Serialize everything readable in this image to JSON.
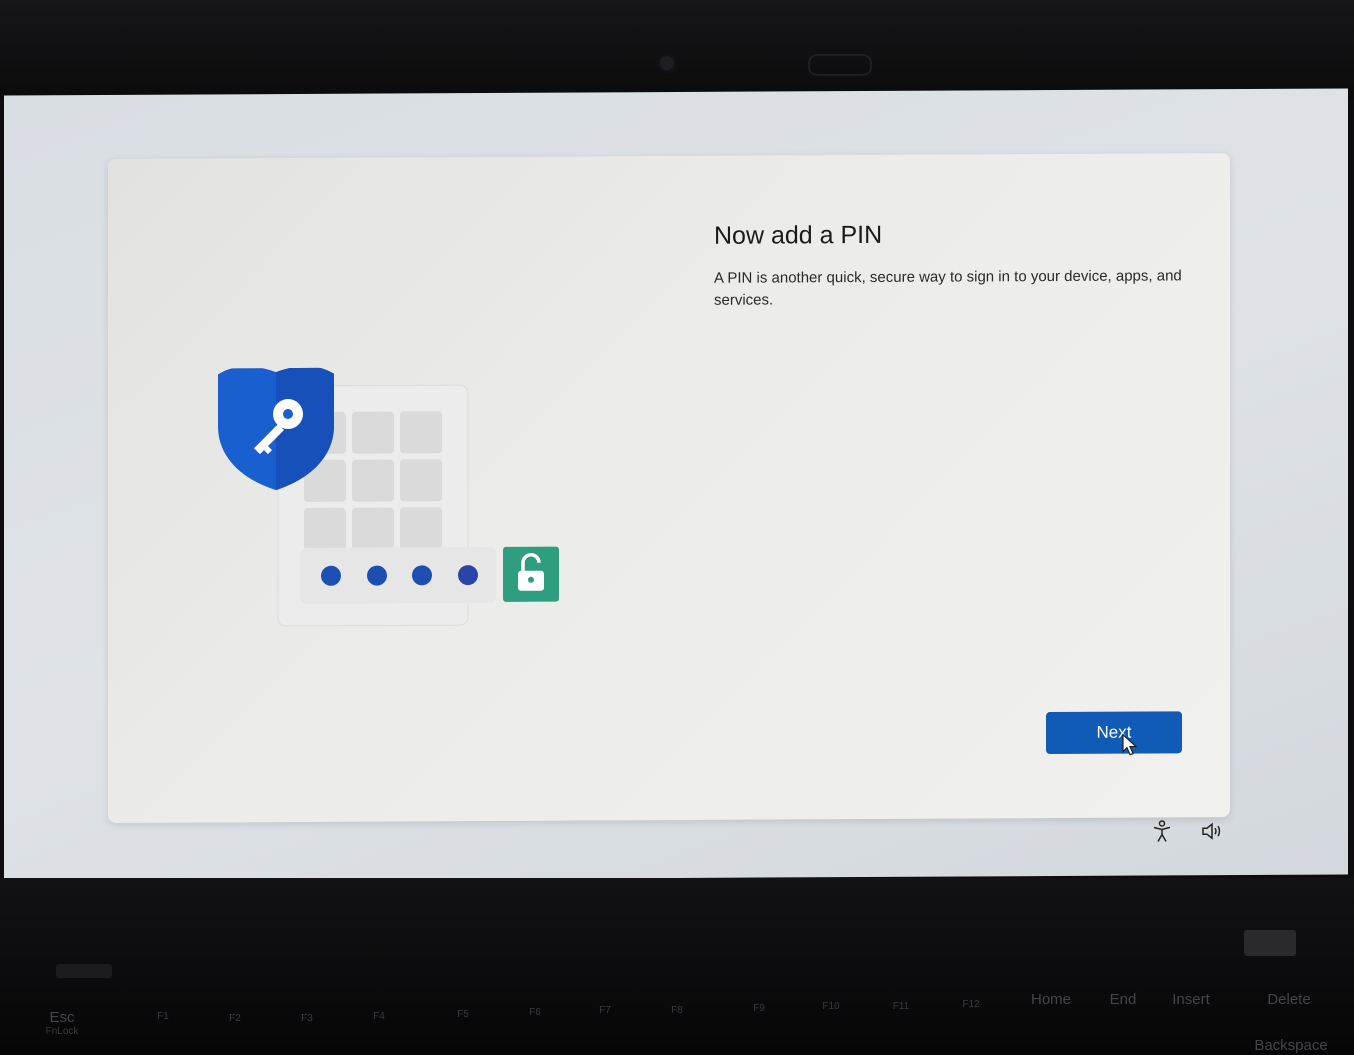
{
  "screen": {
    "title": "Now add a PIN",
    "description": "A PIN is another quick, secure way to sign in to your device, apps, and services.",
    "next_button_label": "Next",
    "accessibility_icon": "accessibility-icon",
    "volume_icon": "volume-icon"
  },
  "colors": {
    "accent": "#0f5bb5",
    "shield": "#1a5fcf",
    "lock_tile": "#2e9e7e",
    "pin_dot": "#1d4fb3"
  },
  "keyboard": {
    "keys": [
      {
        "label": "Esc",
        "sub": "FnLock"
      },
      {
        "label": "",
        "sub": "F1"
      },
      {
        "label": "",
        "sub": "F2"
      },
      {
        "label": "",
        "sub": "F3"
      },
      {
        "label": "",
        "sub": "F4"
      },
      {
        "label": "",
        "sub": "F5"
      },
      {
        "label": "",
        "sub": "F6"
      },
      {
        "label": "",
        "sub": "F7"
      },
      {
        "label": "",
        "sub": "F8"
      },
      {
        "label": "",
        "sub": "F9"
      },
      {
        "label": "",
        "sub": "F10"
      },
      {
        "label": "",
        "sub": "F11"
      },
      {
        "label": "",
        "sub": "F12"
      },
      {
        "label": "Home",
        "sub": ""
      },
      {
        "label": "End",
        "sub": ""
      },
      {
        "label": "Insert",
        "sub": ""
      },
      {
        "label": "Delete",
        "sub": ""
      },
      {
        "label": "Backspace",
        "sub": ""
      }
    ]
  }
}
